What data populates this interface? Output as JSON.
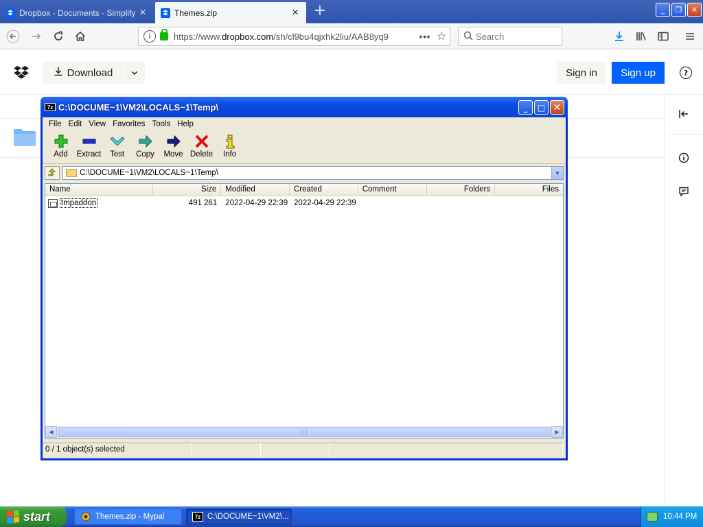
{
  "browser": {
    "tabs": [
      {
        "title": "Dropbox - Documents - Simplify y",
        "active": false
      },
      {
        "title": "Themes.zip",
        "active": true
      }
    ],
    "url_prefix": "https://www.",
    "url_domain": "dropbox.com",
    "url_path": "/sh/cl9bu4qjxhk2liu/AAB8yq9",
    "search_placeholder": "Search"
  },
  "dropbox": {
    "download_label": "Download",
    "signin_label": "Sign in",
    "signup_label": "Sign up",
    "brand_color": "#0061fe"
  },
  "zip_window": {
    "title": "C:\\DOCUME~1\\VM2\\LOCALS~1\\Temp\\",
    "app_badge": "7z",
    "menu": [
      "File",
      "Edit",
      "View",
      "Favorites",
      "Tools",
      "Help"
    ],
    "toolbar": [
      {
        "label": "Add",
        "icon": "plus-icon"
      },
      {
        "label": "Extract",
        "icon": "minus-icon"
      },
      {
        "label": "Test",
        "icon": "check-icon"
      },
      {
        "label": "Copy",
        "icon": "copy-arrow-icon"
      },
      {
        "label": "Move",
        "icon": "move-arrow-icon"
      },
      {
        "label": "Delete",
        "icon": "delete-x-icon"
      },
      {
        "label": "Info",
        "icon": "info-icon"
      }
    ],
    "address": "C:\\DOCUME~1\\VM2\\LOCALS~1\\Temp\\",
    "columns": [
      "Name",
      "Size",
      "Modified",
      "Created",
      "Comment",
      "Folders",
      "Files"
    ],
    "rows": [
      {
        "name": "tmpaddon",
        "size": "491 261",
        "modified": "2022-04-29 22:39",
        "created": "2022-04-29 22:39",
        "comment": "",
        "folders": "",
        "files": ""
      }
    ],
    "status": "0 / 1 object(s) selected"
  },
  "taskbar": {
    "start_label": "start",
    "items": [
      {
        "label": "Themes.zip - Mypal"
      },
      {
        "label": "C:\\DOCUME~1\\VM2\\..."
      }
    ],
    "badge": "7z",
    "clock": "10:44 PM"
  }
}
